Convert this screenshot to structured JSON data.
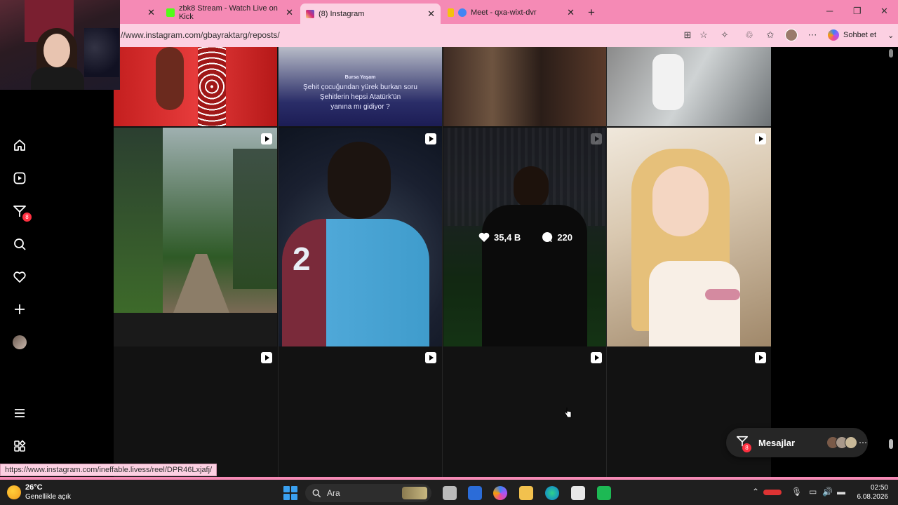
{
  "browser": {
    "tabs": [
      {
        "label": "",
        "favicon_color": "#f58ab5"
      },
      {
        "label": "zbk8 Stream - Watch Live on Kick",
        "favicon_color": "#53fc18"
      },
      {
        "label": "(8) Instagram",
        "favicon_color": "#d62976"
      },
      {
        "label": "Meet - qxa-wixt-dvr",
        "favicon_color": "#4285f4"
      }
    ],
    "new_tab": "+",
    "url": "//www.instagram.com/gbayraktarg/reposts/",
    "chat_label": "Sohbet et"
  },
  "instagram": {
    "notification_count": "8",
    "posts": [
      {
        "caption_source": "Bursa Yaşam",
        "caption_line1": "Şehit çocuğundan yürek burkan soru",
        "caption_line2": "Şehitlerin hepsi Atatürk'ün",
        "caption_line3": "yanına mı gidiyor ?"
      }
    ],
    "hover_stats": {
      "likes": "35,4 B",
      "comments": "220"
    },
    "messages_label": "Mesajlar",
    "messages_badge": "8"
  },
  "status_url": "https://www.instagram.com/ineffable.livess/reel/DPR46Lxjafj/",
  "taskbar": {
    "temperature": "26°C",
    "weather": "Genellikle açık",
    "search_placeholder": "Ara",
    "time": "02:50",
    "date": "6.08.2026"
  },
  "colors": {
    "accent_pink": "#f58ab5",
    "badge_red": "#ff3040"
  }
}
